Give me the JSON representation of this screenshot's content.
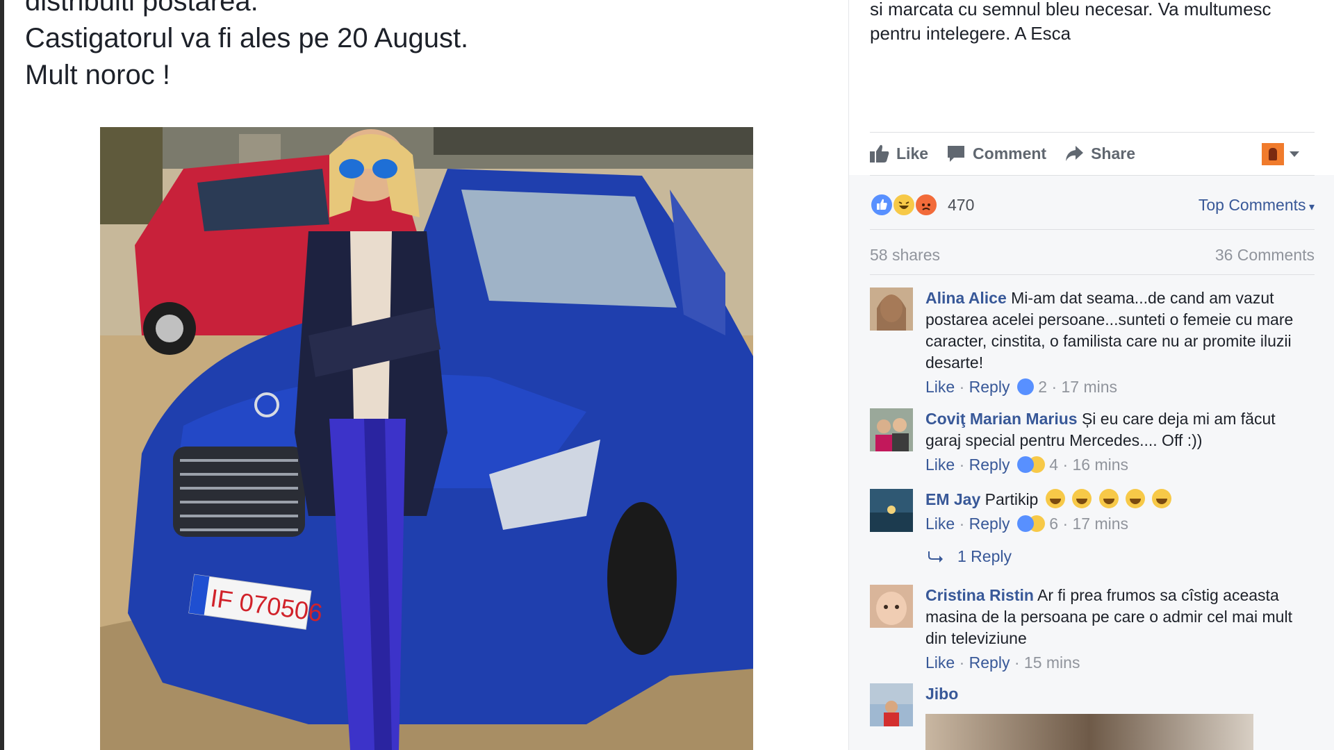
{
  "post": {
    "text_lines": [
      "distribuiti postarea.",
      "Castigatorul va fi ales pe 20 August.",
      "Mult noroc !"
    ],
    "photo": {
      "plate_text": "IF 070506"
    }
  },
  "sidebar": {
    "description_lines": [
      "si marcata cu semnul bleu necesar. Va multumesc",
      "pentru intelegere. A Esca"
    ],
    "actions": {
      "like": "Like",
      "comment": "Comment",
      "share": "Share"
    },
    "reactions": {
      "count": "470",
      "sort_label": "Top Comments"
    },
    "meta": {
      "shares": "58 shares",
      "comments": "36 Comments"
    },
    "comments": [
      {
        "name": "Alina Alice",
        "text": "Mi-am dat seama...de cand am vazut postarea acelei persoane...sunteti o femeie cu mare caracter, cinstita, o familista care nu ar promite iluzii desarte!",
        "like": "Like",
        "reply": "Reply",
        "reactions": "2",
        "time": "17 mins"
      },
      {
        "name": "Coviţ Marian Marius",
        "text": "Și eu care deja mi am făcut garaj special pentru Mercedes.... Off :))",
        "like": "Like",
        "reply": "Reply",
        "reactions": "4",
        "time": "16 mins"
      },
      {
        "name": "EM Jay",
        "text": "Partikip",
        "like": "Like",
        "reply": "Reply",
        "reactions": "6",
        "time": "17 mins",
        "replies_label": "1 Reply"
      },
      {
        "name": "Cristina Ristin",
        "text": "Ar fi prea frumos sa cîstig aceasta masina de la persoana pe care o admir cel mai mult din televiziune",
        "like": "Like",
        "reply": "Reply",
        "time": "15 mins"
      },
      {
        "name": "Jibo"
      }
    ]
  },
  "icons": {
    "like": "thumbs-up-icon",
    "comment": "speech-bubble-icon",
    "share": "share-arrow-icon",
    "reply_arrow": "reply-arrow-icon"
  },
  "colors": {
    "link": "#385898",
    "muted": "#90949c",
    "action": "#606770",
    "like_blue": "#5890ff"
  }
}
